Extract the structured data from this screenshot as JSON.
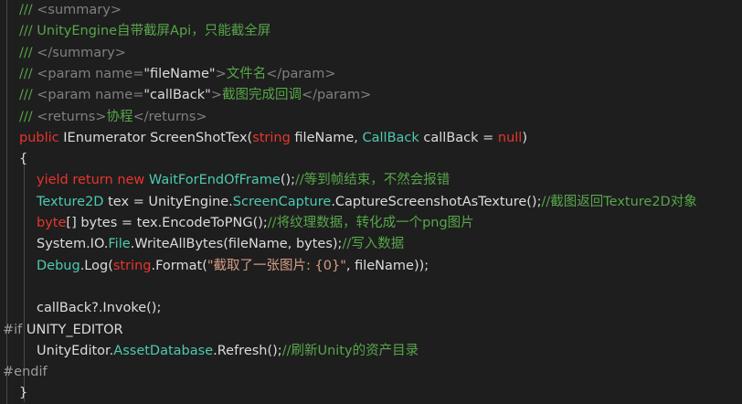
{
  "lines": [
    [
      {
        "t": "/// ",
        "c": "cm"
      },
      {
        "t": "<summary>",
        "c": "xml"
      }
    ],
    [
      {
        "t": "/// UnityEngine自带截屏Api，只能截全屏",
        "c": "cm"
      }
    ],
    [
      {
        "t": "/// ",
        "c": "cm"
      },
      {
        "t": "</summary>",
        "c": "xml"
      }
    ],
    [
      {
        "t": "/// ",
        "c": "cm"
      },
      {
        "t": "<param name=",
        "c": "xml"
      },
      {
        "t": "\"fileName\"",
        "c": "def"
      },
      {
        "t": ">",
        "c": "xml"
      },
      {
        "t": "文件名",
        "c": "cm"
      },
      {
        "t": "</param>",
        "c": "xml"
      }
    ],
    [
      {
        "t": "/// ",
        "c": "cm"
      },
      {
        "t": "<param name=",
        "c": "xml"
      },
      {
        "t": "\"callBack\"",
        "c": "def"
      },
      {
        "t": ">",
        "c": "xml"
      },
      {
        "t": "截图完成回调",
        "c": "cm"
      },
      {
        "t": "</param>",
        "c": "xml"
      }
    ],
    [
      {
        "t": "/// ",
        "c": "cm"
      },
      {
        "t": "<returns>",
        "c": "xml"
      },
      {
        "t": "协程",
        "c": "cm"
      },
      {
        "t": "</returns>",
        "c": "xml"
      }
    ],
    [
      {
        "t": "public ",
        "c": "kw"
      },
      {
        "t": "IEnumerator ScreenShotTex(",
        "c": "def"
      },
      {
        "t": "string",
        "c": "kw"
      },
      {
        "t": " fileName, ",
        "c": "def"
      },
      {
        "t": "CallBack",
        "c": "typ"
      },
      {
        "t": " callBack = ",
        "c": "def"
      },
      {
        "t": "null",
        "c": "kw"
      },
      {
        "t": ")",
        "c": "def"
      }
    ],
    [
      {
        "t": "{",
        "c": "def"
      }
    ],
    [
      {
        "t": "yield return new ",
        "c": "kw"
      },
      {
        "t": "WaitForEndOfFrame",
        "c": "typ"
      },
      {
        "t": "();",
        "c": "def"
      },
      {
        "t": "//等到帧结束，不然会报错",
        "c": "cm"
      }
    ],
    [
      {
        "t": "Texture2D",
        "c": "typ"
      },
      {
        "t": " tex = UnityEngine.",
        "c": "def"
      },
      {
        "t": "ScreenCapture",
        "c": "typ"
      },
      {
        "t": ".CaptureScreenshotAsTexture();",
        "c": "def"
      },
      {
        "t": "//截图返回Texture2D对象",
        "c": "cm"
      }
    ],
    [
      {
        "t": "byte",
        "c": "kw"
      },
      {
        "t": "[] bytes = tex.EncodeToPNG();",
        "c": "def"
      },
      {
        "t": "//将纹理数据，转化成一个png图片",
        "c": "cm"
      }
    ],
    [
      {
        "t": "System.IO.",
        "c": "def"
      },
      {
        "t": "File",
        "c": "typ"
      },
      {
        "t": ".WriteAllBytes(fileName, bytes);",
        "c": "def"
      },
      {
        "t": "//写入数据",
        "c": "cm"
      }
    ],
    [
      {
        "t": "Debug",
        "c": "typ"
      },
      {
        "t": ".Log(",
        "c": "def"
      },
      {
        "t": "string",
        "c": "kw"
      },
      {
        "t": ".Format(",
        "c": "def"
      },
      {
        "t": "\"截取了一张图片: {0}\"",
        "c": "str"
      },
      {
        "t": ", fileName));",
        "c": "def"
      }
    ],
    [],
    [
      {
        "t": "callBack?.Invoke();",
        "c": "def"
      }
    ],
    [
      {
        "t": "#if",
        "c": "pre"
      },
      {
        "t": " UNITY_EDITOR",
        "c": "def"
      }
    ],
    [
      {
        "t": "UnityEditor.",
        "c": "def"
      },
      {
        "t": "AssetDatabase",
        "c": "typ"
      },
      {
        "t": ".Refresh();",
        "c": "def"
      },
      {
        "t": "//刷新Unity的资产目录",
        "c": "cm"
      }
    ],
    [
      {
        "t": "#endif",
        "c": "pre"
      }
    ],
    [
      {
        "t": "}",
        "c": "def"
      }
    ]
  ],
  "indent": [
    1,
    1,
    1,
    1,
    1,
    1,
    1,
    1,
    2,
    2,
    2,
    2,
    2,
    2,
    2,
    0,
    2,
    0,
    1
  ]
}
